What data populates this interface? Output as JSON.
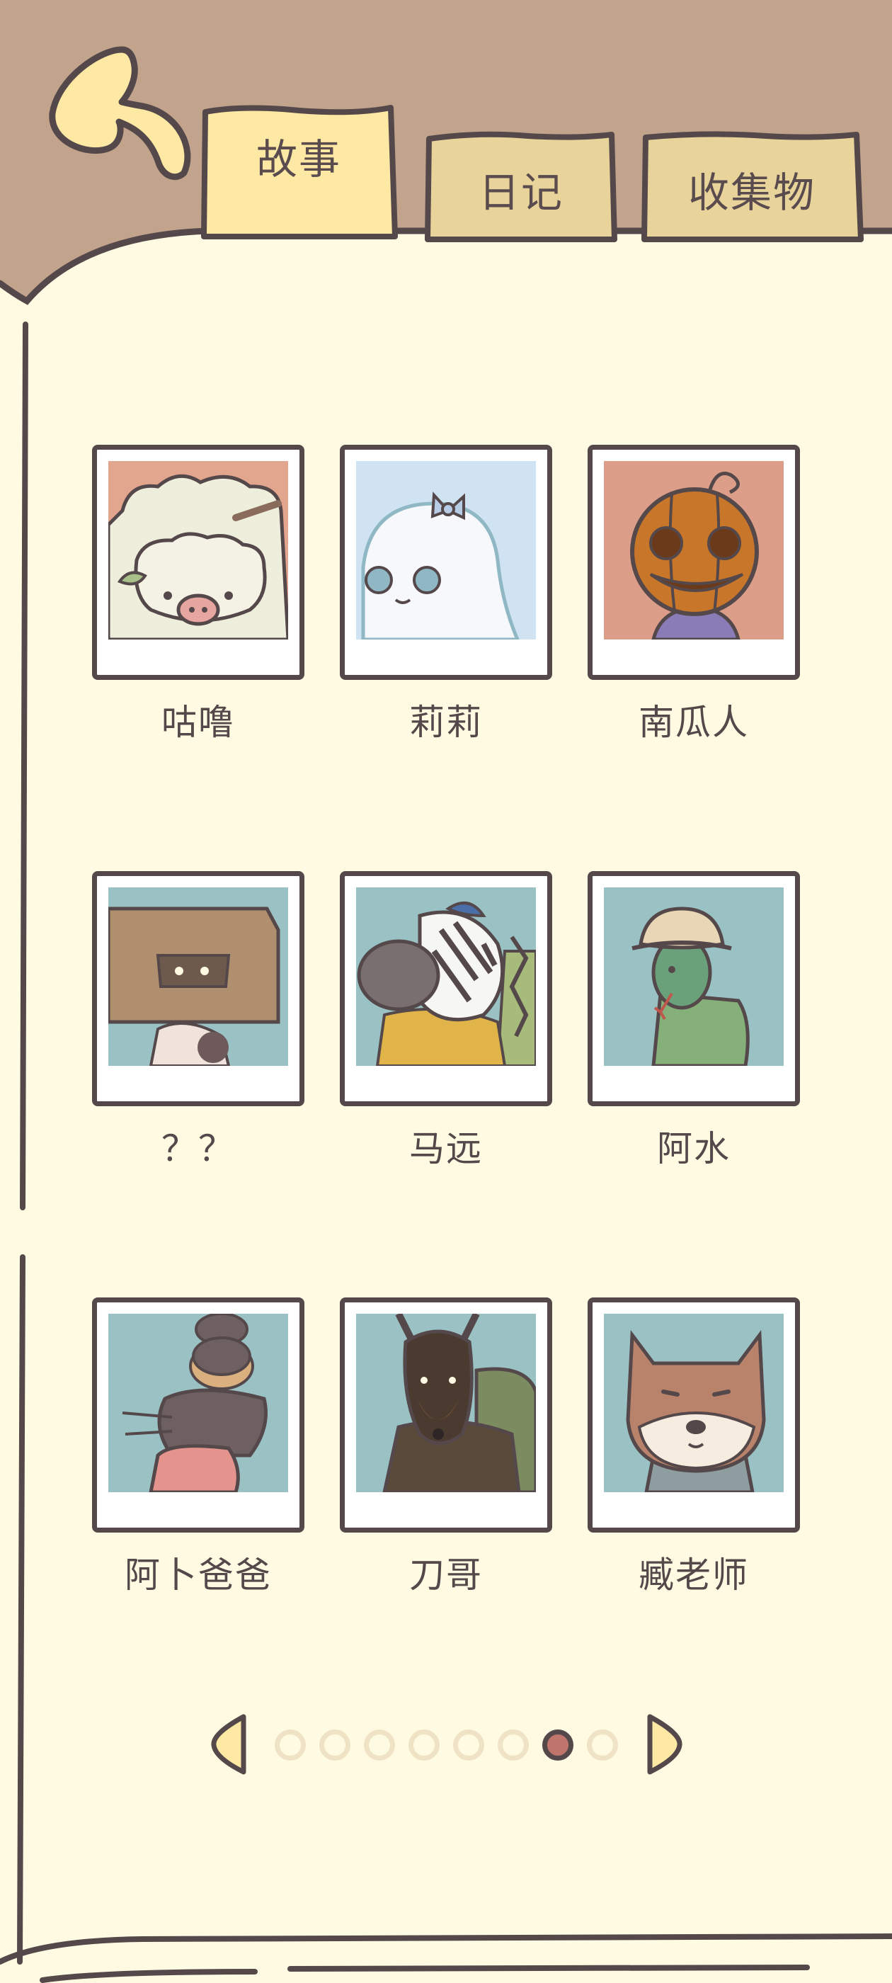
{
  "colors": {
    "header_bg": "#c2a48c",
    "page_bg": "#fffbe2",
    "ink": "#55484a",
    "tab_active": "#fde8a4",
    "tab_inactive": "#e8d39a",
    "dot_inactive": "#f0e2c4",
    "dot_active": "#c0756c"
  },
  "tabs": [
    {
      "label": "故事",
      "active": true
    },
    {
      "label": "日记",
      "active": false
    },
    {
      "label": "收集物",
      "active": false
    }
  ],
  "characters": [
    {
      "name": "咕噜",
      "icon": "sheep-pig-portrait"
    },
    {
      "name": "莉莉",
      "icon": "ghost-girl-portrait"
    },
    {
      "name": "南瓜人",
      "icon": "pumpkin-head-portrait"
    },
    {
      "name": "？？",
      "icon": "box-head-portrait"
    },
    {
      "name": "马远",
      "icon": "zebra-portrait"
    },
    {
      "name": "阿水",
      "icon": "snake-hat-portrait"
    },
    {
      "name": "阿卜爸爸",
      "icon": "rat-stack-portrait"
    },
    {
      "name": "刀哥",
      "icon": "doberman-portrait"
    },
    {
      "name": "臧老师",
      "icon": "shiba-portrait"
    }
  ],
  "pagination": {
    "total_pages": 8,
    "current_page": 7
  }
}
